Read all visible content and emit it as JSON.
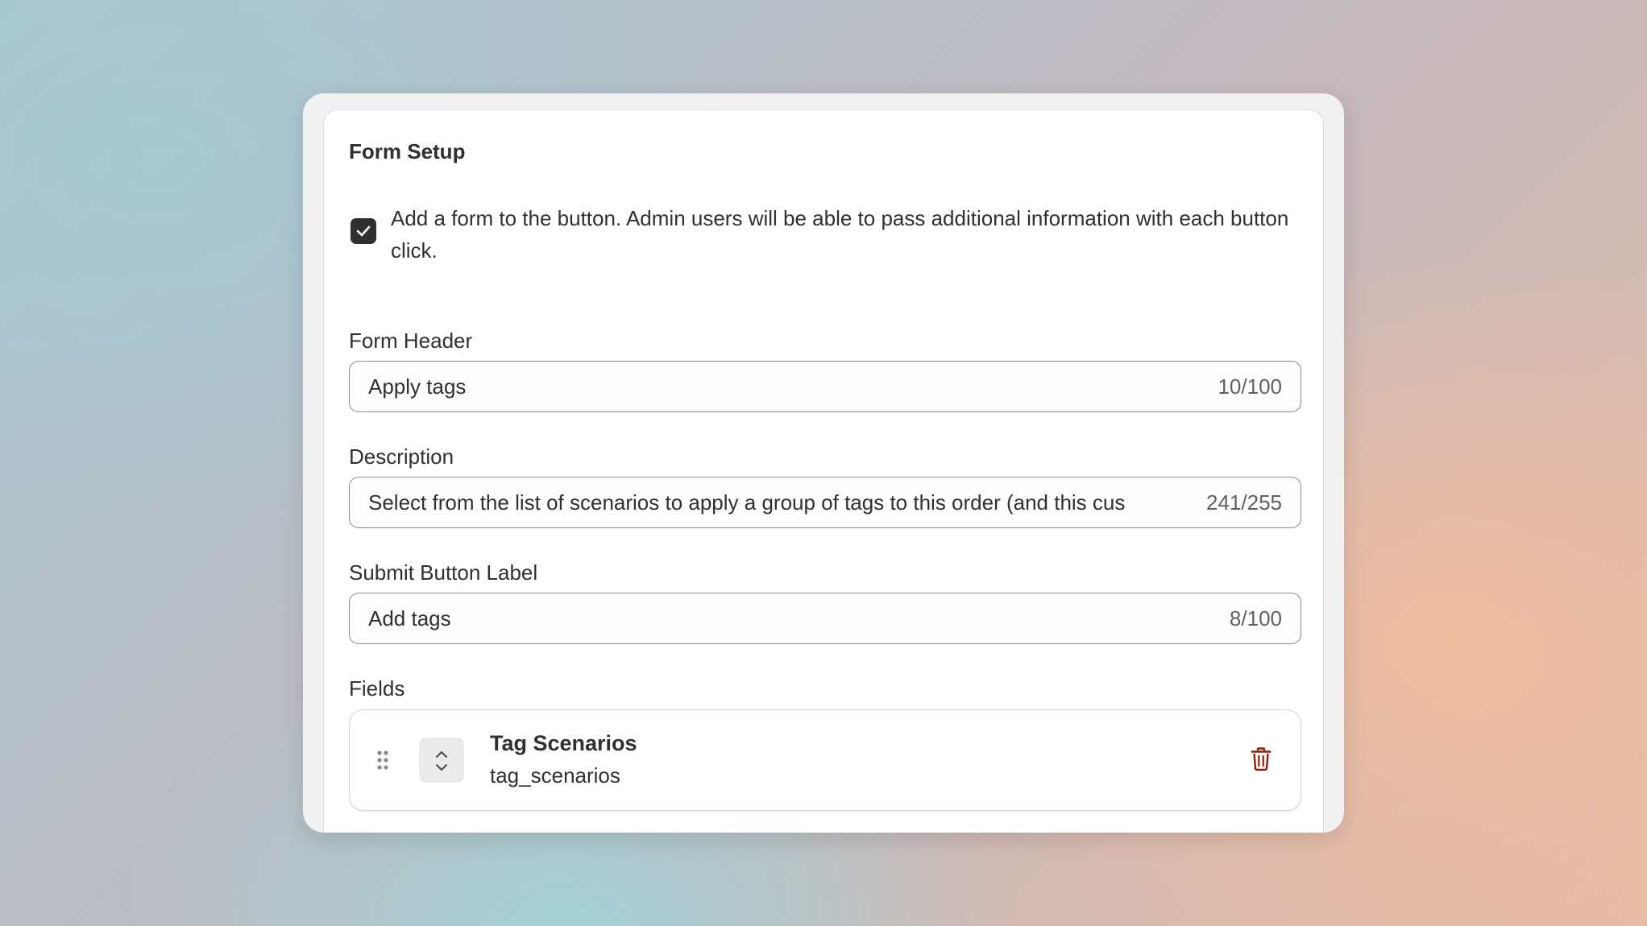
{
  "section": {
    "title": "Form Setup"
  },
  "checkbox": {
    "checked": true,
    "text": "Add a form to the button. Admin users will be able to pass additional information with each button click."
  },
  "form_header": {
    "label": "Form Header",
    "value": "Apply tags",
    "counter": "10/100"
  },
  "description": {
    "label": "Description",
    "value": "Select from the list of scenarios to apply a group of tags to this order (and this cus",
    "counter": "241/255"
  },
  "submit_label": {
    "label": "Submit Button Label",
    "value": "Add tags",
    "counter": "8/100"
  },
  "fields": {
    "label": "Fields",
    "items": [
      {
        "name": "Tag Scenarios",
        "key": "tag_scenarios",
        "icons": [
          "drag-handle-icon",
          "select-chevron-icon",
          "trash-icon"
        ]
      }
    ]
  },
  "colors": {
    "checkbox_fill": "#303030",
    "trash": "#8e1f0b",
    "border": "#8a8a8a"
  }
}
